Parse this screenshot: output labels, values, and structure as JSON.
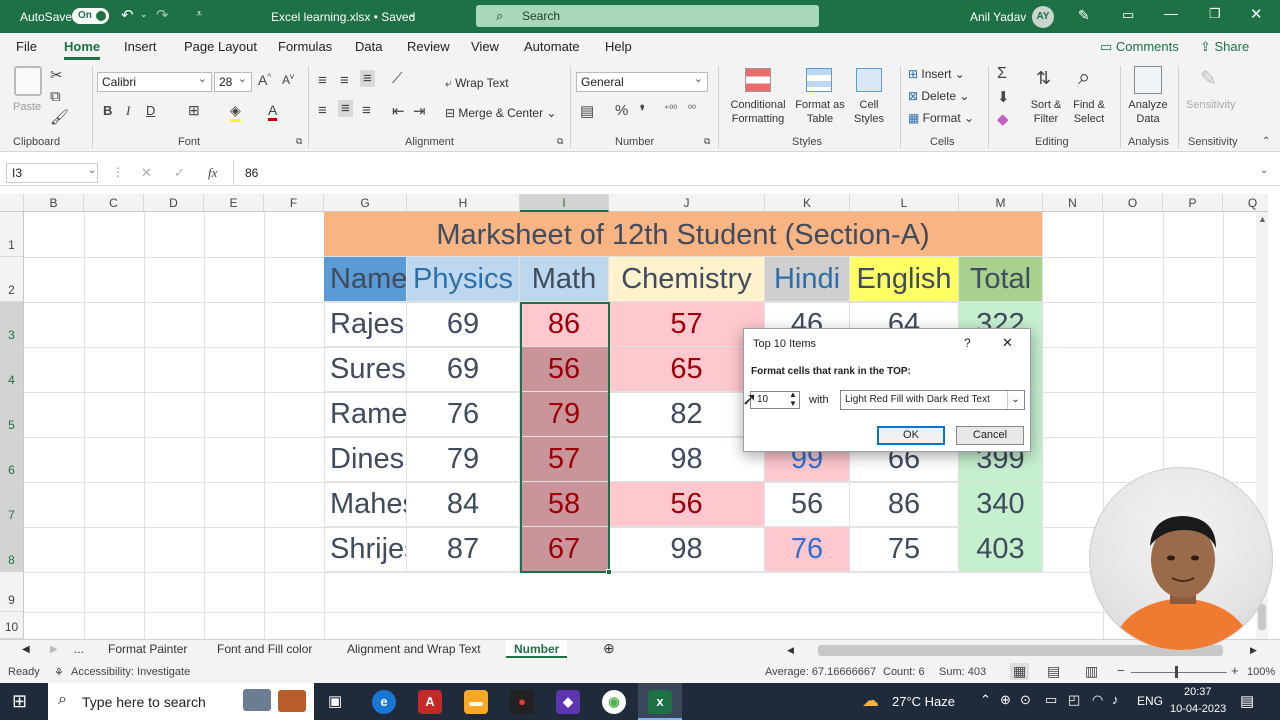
{
  "titlebar": {
    "autosave_label": "AutoSave",
    "autosave_state": "On",
    "file_title": "Excel learning.xlsx • Saved",
    "search_placeholder": "Search",
    "user_name": "Anil Yadav",
    "user_initials": "AY"
  },
  "ribbon_tabs": [
    "File",
    "Home",
    "Insert",
    "Page Layout",
    "Formulas",
    "Data",
    "Review",
    "View",
    "Automate",
    "Help"
  ],
  "ribbon_right": {
    "comments": "Comments",
    "share": "Share"
  },
  "ribbon": {
    "clipboard": {
      "paste": "Paste",
      "group": "Clipboard"
    },
    "font": {
      "name": "Calibri",
      "size": "28",
      "group": "Font"
    },
    "alignment": {
      "wrap": "Wrap Text",
      "merge": "Merge & Center",
      "group": "Alignment"
    },
    "number": {
      "format": "General",
      "group": "Number"
    },
    "styles": {
      "conditional": "Conditional Formatting",
      "format_table": "Format as Table",
      "cell_styles": "Cell Styles",
      "group": "Styles"
    },
    "cells": {
      "insert": "Insert",
      "delete": "Delete",
      "format": "Format",
      "group": "Cells"
    },
    "editing": {
      "sort": "Sort & Filter",
      "find": "Find & Select",
      "group": "Editing"
    },
    "analysis": {
      "analyze": "Analyze Data",
      "group": "Analysis"
    },
    "sensitivity": {
      "label": "Sensitivity",
      "group": "Sensitivity"
    }
  },
  "formula_bar": {
    "name_box": "I3",
    "fx": "fx",
    "value": "86"
  },
  "columns": [
    "B",
    "C",
    "D",
    "E",
    "F",
    "G",
    "H",
    "I",
    "J",
    "K",
    "L",
    "M",
    "N",
    "O",
    "P",
    "Q"
  ],
  "rows": [
    "1",
    "2",
    "3",
    "4",
    "5",
    "6",
    "7",
    "8",
    "9",
    "10"
  ],
  "sheet": {
    "title": "Marksheet of 12th Student (Section-A)",
    "headers": [
      "Name",
      "Physics",
      "Math",
      "Chemistry",
      "Hindi",
      "English",
      "Total"
    ],
    "data": [
      [
        "Rajesh",
        "69",
        "86",
        "57",
        "46",
        "64",
        "322"
      ],
      [
        "Suresh",
        "69",
        "56",
        "65",
        "",
        "",
        ""
      ],
      [
        "Ramesh",
        "76",
        "79",
        "82",
        "",
        "",
        ""
      ],
      [
        "Dinesh",
        "79",
        "57",
        "98",
        "99",
        "66",
        "399"
      ],
      [
        "Mahesh",
        "84",
        "58",
        "56",
        "56",
        "86",
        "340"
      ],
      [
        "Shrijesh",
        "87",
        "67",
        "98",
        "76",
        "75",
        "403"
      ]
    ]
  },
  "colors": {
    "excel_green": "#1e7145",
    "title_fill": "#f8b483",
    "name_header": "#5b9bd5",
    "physics_header": "#bdd7ee",
    "chem_header": "#fff2cc",
    "hindi_header": "#d0cece",
    "english_header": "#ffff66",
    "total_header": "#a9d18e",
    "light_red": "#ffc7ce",
    "dark_red_text": "#9c0006",
    "math_dark": "#c9959a",
    "total_green": "#c6efce"
  },
  "dialog": {
    "title": "Top 10 Items",
    "help": "?",
    "close": "✕",
    "label": "Format cells that rank in the TOP:",
    "count": "10",
    "with": "with",
    "format_option": "Light Red Fill with Dark Red Text",
    "ok": "OK",
    "cancel": "Cancel"
  },
  "sheet_tabs": [
    "...",
    "Format Painter",
    "Font and Fill color",
    "Alignment and Wrap Text",
    "Number"
  ],
  "status": {
    "ready": "Ready",
    "accessibility": "Accessibility: Investigate",
    "average": "Average: 67.16666667",
    "count": "Count: 6",
    "sum": "Sum: 403",
    "zoom": "100%"
  },
  "taskbar": {
    "search": "Type here to search",
    "weather": "27°C  Haze",
    "lang": "ENG",
    "time": "20:37",
    "date": "10-04-2023"
  }
}
